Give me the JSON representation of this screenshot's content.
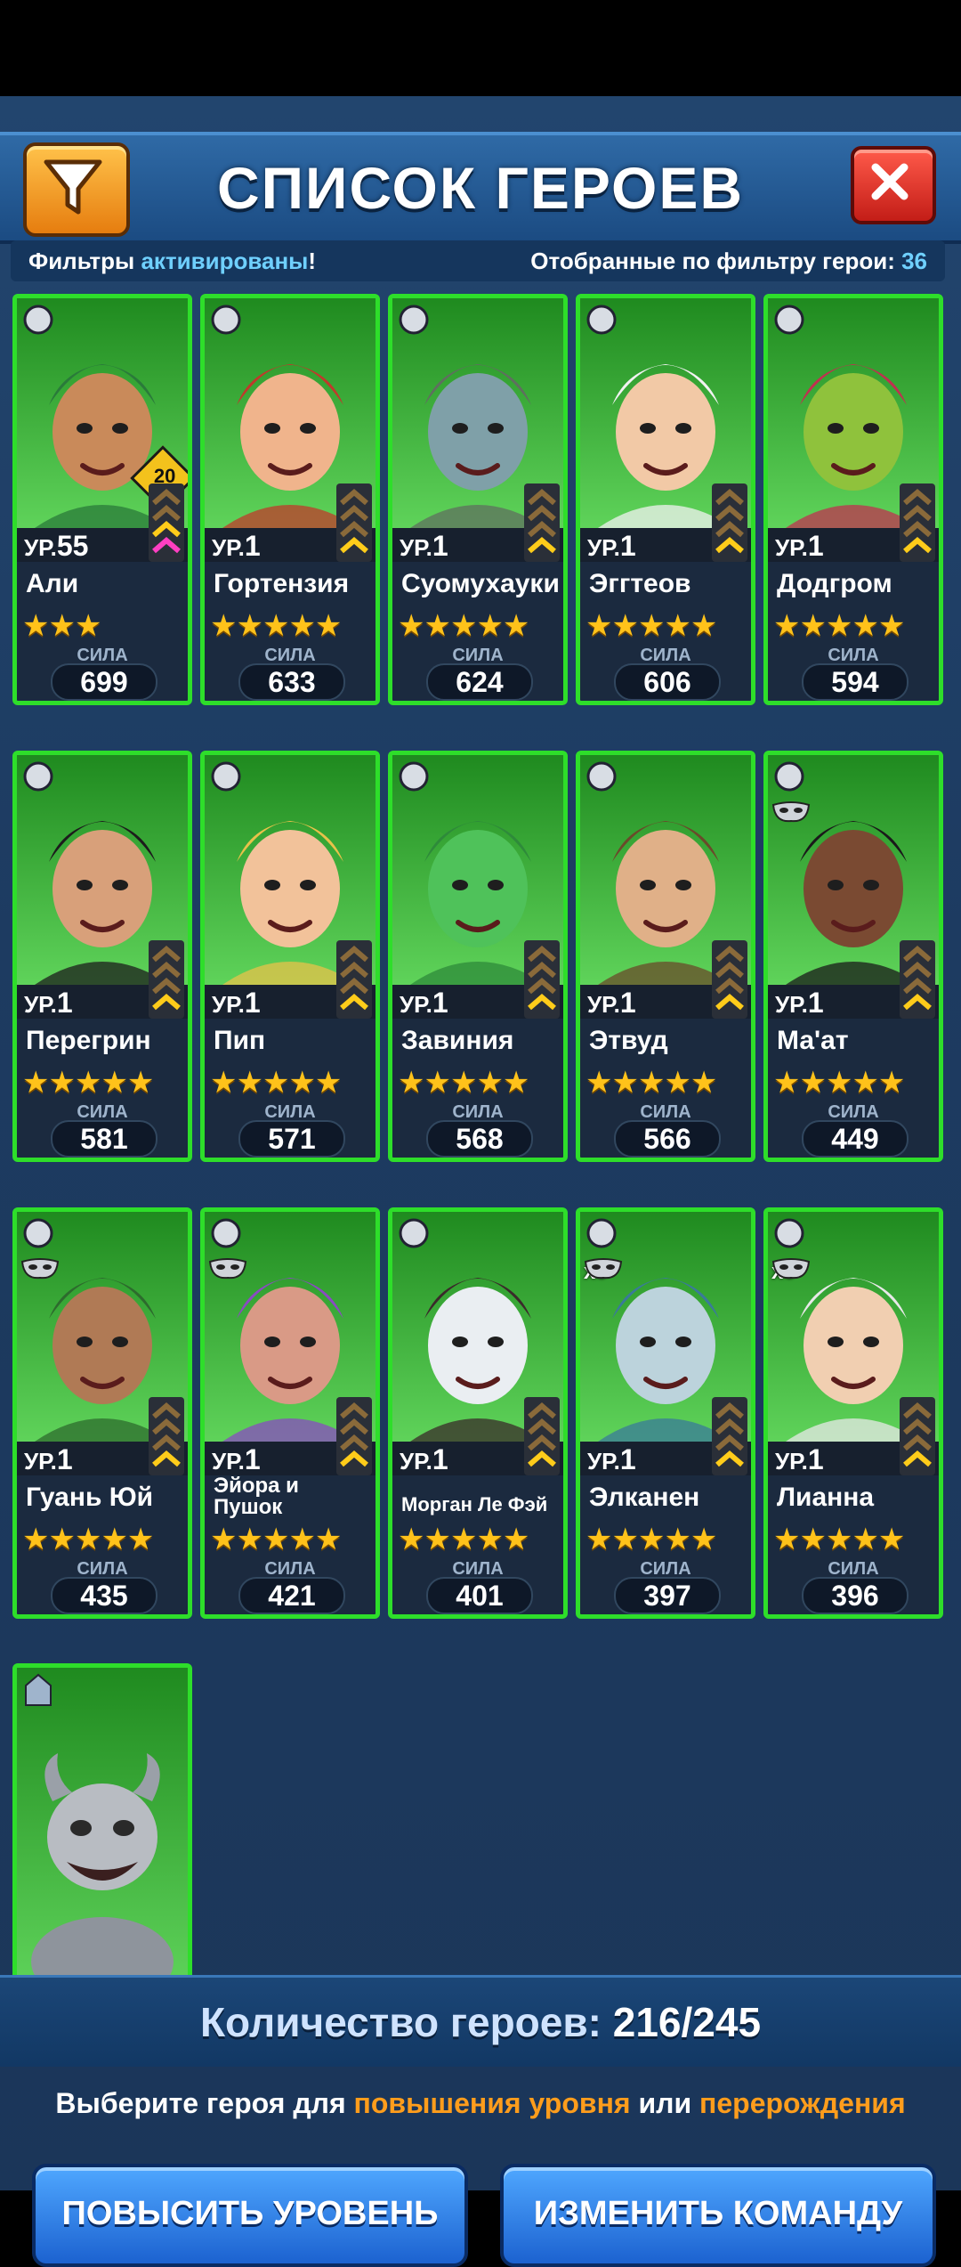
{
  "header": {
    "title": "СПИСОК ГЕРОЕВ"
  },
  "info": {
    "filters_prefix": "Фильтры ",
    "filters_state": "активированы",
    "filters_suffix": "!",
    "filtered_label": "Отобранные по фильтру герои: ",
    "filtered_count": "36"
  },
  "heroes": [
    {
      "level_prefix": "УР.",
      "level": "55",
      "name": "Али",
      "stars": "★★★",
      "power_label": "СИЛА",
      "power": "699",
      "tier": "20"
    },
    {
      "level_prefix": "УР.",
      "level": "1",
      "name": "Гортензия",
      "stars": "★★★★★",
      "power_label": "СИЛА",
      "power": "633"
    },
    {
      "level_prefix": "УР.",
      "level": "1",
      "name": "Суомухауки",
      "stars": "★★★★★",
      "power_label": "СИЛА",
      "power": "624"
    },
    {
      "level_prefix": "УР.",
      "level": "1",
      "name": "Эггтеов",
      "stars": "★★★★★",
      "power_label": "СИЛА",
      "power": "606"
    },
    {
      "level_prefix": "УР.",
      "level": "1",
      "name": "Додгром",
      "stars": "★★★★★",
      "power_label": "СИЛА",
      "power": "594"
    },
    {
      "level_prefix": "УР.",
      "level": "1",
      "name": "Перегрин",
      "stars": "★★★★★",
      "power_label": "СИЛА",
      "power": "581"
    },
    {
      "level_prefix": "УР.",
      "level": "1",
      "name": "Пип",
      "stars": "★★★★★",
      "power_label": "СИЛА",
      "power": "571"
    },
    {
      "level_prefix": "УР.",
      "level": "1",
      "name": "Завиния",
      "stars": "★★★★★",
      "power_label": "СИЛА",
      "power": "568"
    },
    {
      "level_prefix": "УР.",
      "level": "1",
      "name": "Этвуд",
      "stars": "★★★★★",
      "power_label": "СИЛА",
      "power": "566"
    },
    {
      "level_prefix": "УР.",
      "level": "1",
      "name": "Ма'ат",
      "stars": "★★★★★",
      "power_label": "СИЛА",
      "power": "449"
    },
    {
      "level_prefix": "УР.",
      "level": "1",
      "name": "Гуань Юй",
      "stars": "★★★★★",
      "power_label": "СИЛА",
      "power": "435"
    },
    {
      "level_prefix": "УР.",
      "level": "1",
      "name": "Эйора и Пушок",
      "stars": "★★★★★",
      "power_label": "СИЛА",
      "power": "421"
    },
    {
      "level_prefix": "УР.",
      "level": "1",
      "name": "Морган Ле Фэй",
      "stars": "★★★★★",
      "power_label": "СИЛА",
      "power": "401"
    },
    {
      "level_prefix": "УР.",
      "level": "1",
      "name": "Элканен",
      "stars": "★★★★★",
      "power_label": "СИЛА",
      "power": "397",
      "badge": "x5"
    },
    {
      "level_prefix": "УР.",
      "level": "1",
      "name": "Лианна",
      "stars": "★★★★★",
      "power_label": "СИЛА",
      "power": "396",
      "badge": "x3"
    }
  ],
  "footer": {
    "count_label": "Количество героев: ",
    "count_value": "216/245",
    "hint_prefix": "Выберите героя для ",
    "hint_levelup": "повышения уровня",
    "hint_or": " или ",
    "hint_rebirth": "перерождения",
    "levelup_button": "ПОВЫСИТЬ УРОВЕНЬ",
    "change_team_button": "ИЗМЕНИТЬ КОМАНДУ"
  },
  "colors": {
    "card_border": "#2ede2a",
    "accent_blue": "#6fd0ff",
    "accent_orange": "#ff9d1c",
    "star": "#ffc21a"
  }
}
